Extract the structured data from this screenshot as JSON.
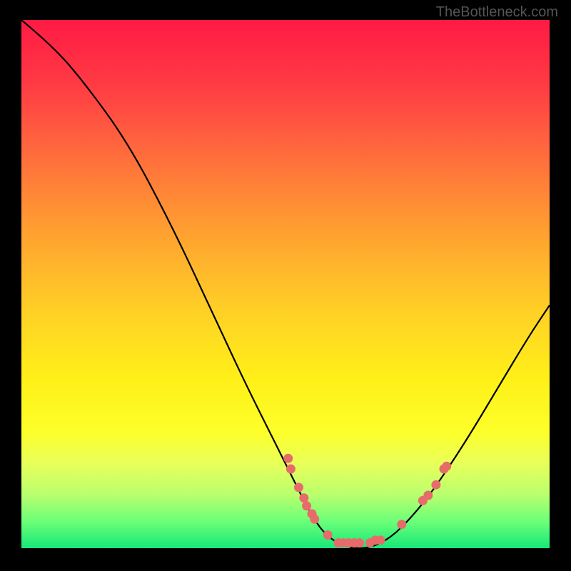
{
  "watermark": "TheBottleneck.com",
  "chart_data": {
    "type": "line",
    "title": "",
    "xlabel": "",
    "ylabel": "",
    "xlim": [
      0,
      100
    ],
    "ylim": [
      0,
      100
    ],
    "curve": [
      {
        "x": 0,
        "y": 100
      },
      {
        "x": 6,
        "y": 95
      },
      {
        "x": 12,
        "y": 88
      },
      {
        "x": 20,
        "y": 77
      },
      {
        "x": 28,
        "y": 62
      },
      {
        "x": 36,
        "y": 45
      },
      {
        "x": 42,
        "y": 32
      },
      {
        "x": 48,
        "y": 20
      },
      {
        "x": 52,
        "y": 12
      },
      {
        "x": 55,
        "y": 6
      },
      {
        "x": 58,
        "y": 2
      },
      {
        "x": 62,
        "y": 0
      },
      {
        "x": 66,
        "y": 0
      },
      {
        "x": 70,
        "y": 2
      },
      {
        "x": 74,
        "y": 6
      },
      {
        "x": 78,
        "y": 11
      },
      {
        "x": 84,
        "y": 20
      },
      {
        "x": 90,
        "y": 30
      },
      {
        "x": 96,
        "y": 40
      },
      {
        "x": 100,
        "y": 46
      }
    ],
    "markers": [
      {
        "x": 50.5,
        "y": 17
      },
      {
        "x": 51,
        "y": 15
      },
      {
        "x": 52.5,
        "y": 11.5
      },
      {
        "x": 53.5,
        "y": 9.5
      },
      {
        "x": 54,
        "y": 8
      },
      {
        "x": 55,
        "y": 6.5
      },
      {
        "x": 55.5,
        "y": 5.5
      },
      {
        "x": 58,
        "y": 2.5
      },
      {
        "x": 60,
        "y": 1
      },
      {
        "x": 61,
        "y": 1
      },
      {
        "x": 62,
        "y": 1
      },
      {
        "x": 63,
        "y": 1
      },
      {
        "x": 64,
        "y": 1
      },
      {
        "x": 66,
        "y": 1
      },
      {
        "x": 67,
        "y": 1.5
      },
      {
        "x": 68,
        "y": 1.5
      },
      {
        "x": 72,
        "y": 4.5
      },
      {
        "x": 76,
        "y": 9
      },
      {
        "x": 77,
        "y": 10
      },
      {
        "x": 78.5,
        "y": 12
      },
      {
        "x": 80,
        "y": 15
      },
      {
        "x": 80.5,
        "y": 15.5
      }
    ],
    "marker_color": "#e76b6b",
    "curve_color": "#000000"
  }
}
